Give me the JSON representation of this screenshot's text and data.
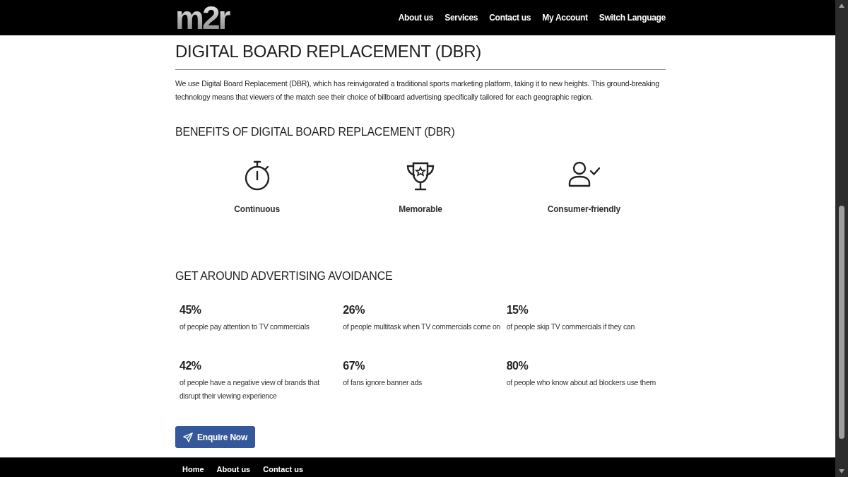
{
  "header": {
    "logo": "m2r",
    "nav": [
      {
        "label": "About us"
      },
      {
        "label": "Services"
      },
      {
        "label": "Contact us"
      },
      {
        "label": "My Account"
      },
      {
        "label": "Switch Language"
      }
    ]
  },
  "page": {
    "title": "DIGITAL BOARD REPLACEMENT (DBR)",
    "intro": "We use Digital Board Replacement (DBR), which has reinvigorated a traditional sports marketing platform, taking it to new heights. This ground-breaking technology means that viewers of the match see their choice of billboard advertising specifically tailored for each geographic region.",
    "benefits": {
      "heading": "BENEFITS OF DIGITAL BOARD REPLACEMENT (DBR)",
      "items": [
        {
          "label": "Continuous"
        },
        {
          "label": "Memorable"
        },
        {
          "label": "Consumer-friendly"
        }
      ]
    },
    "avoidance": {
      "heading": "GET AROUND ADVERTISING AVOIDANCE",
      "stats": [
        {
          "value": "45%",
          "text": "of people pay attention to TV commercials"
        },
        {
          "value": "26%",
          "text": "of people multitask when TV commercials come on"
        },
        {
          "value": "15%",
          "text": "of people skip TV commercials if they can"
        },
        {
          "value": "42%",
          "text": "of people have a negative view of brands that disrupt their viewing experience"
        },
        {
          "value": "67%",
          "text": "of fans ignore banner ads"
        },
        {
          "value": "80%",
          "text": "of people who know about ad blockers use them"
        }
      ]
    },
    "button": {
      "label": "Enquire Now"
    }
  },
  "footer": {
    "links": [
      {
        "label": "Home"
      },
      {
        "label": "About us"
      },
      {
        "label": "Contact us"
      }
    ]
  }
}
